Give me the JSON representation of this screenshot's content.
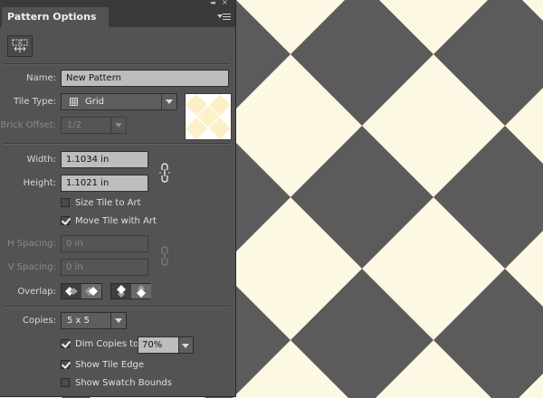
{
  "panel": {
    "title": "Pattern Options",
    "name": {
      "label": "Name:",
      "value": "New Pattern"
    },
    "tile_type": {
      "label": "Tile Type:",
      "value": "Grid",
      "icon": "grid-icon"
    },
    "brick_offset": {
      "label": "Brick Offset:",
      "value": "1/2",
      "enabled": false
    },
    "width": {
      "label": "Width:",
      "value": "1.1034 in"
    },
    "height": {
      "label": "Height:",
      "value": "1.1021 in"
    },
    "size_tile_to_art": {
      "label": "Size Tile to Art",
      "checked": false
    },
    "move_tile_with_art": {
      "label": "Move Tile with Art",
      "checked": true
    },
    "h_spacing": {
      "label": "H Spacing:",
      "value": "0 in",
      "enabled": false
    },
    "v_spacing": {
      "label": "V Spacing:",
      "value": "0 in",
      "enabled": false
    },
    "overlap": {
      "label": "Overlap:"
    },
    "copies": {
      "label": "Copies:",
      "value": "5 x 5"
    },
    "dim_copies": {
      "label": "Dim Copies to:",
      "checked": true,
      "value": "70%"
    },
    "show_tile_edge": {
      "label": "Show Tile Edge",
      "checked": true
    },
    "show_swatch_bounds": {
      "label": "Show Swatch Bounds",
      "checked": false
    }
  },
  "colors": {
    "tile_light": "#fdf8e4",
    "tile_dark": "#5b5b5b",
    "panel_bg": "#535353",
    "field_bg": "#bdbdbd"
  }
}
